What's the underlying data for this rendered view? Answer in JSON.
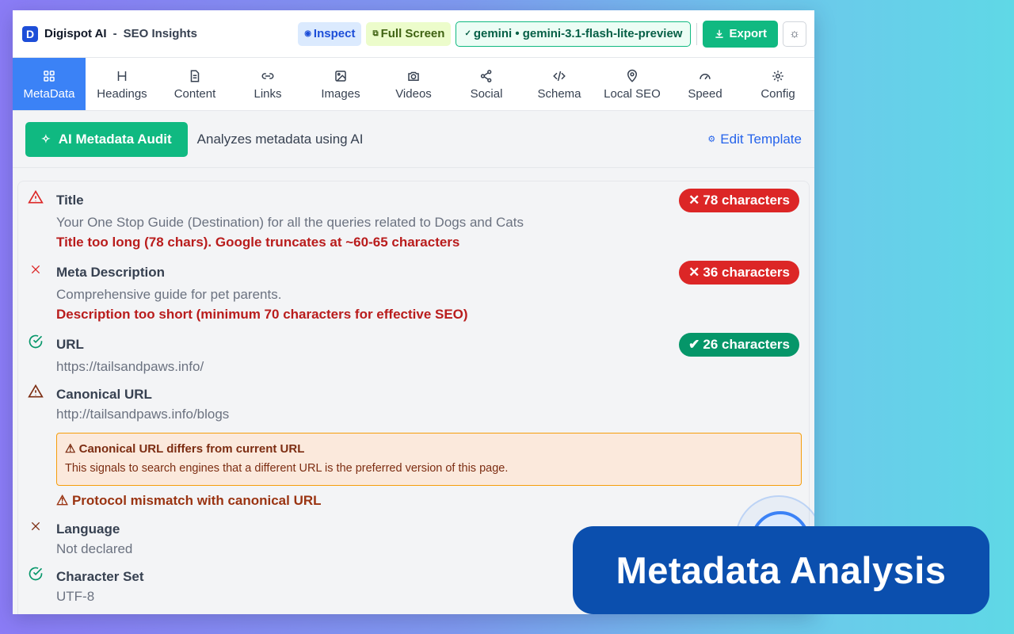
{
  "app": {
    "logo_letter": "D",
    "brand": "Digispot AI",
    "separator": "-",
    "subtitle": "SEO Insights"
  },
  "header": {
    "inspect_label": "Inspect",
    "fullscreen_label": "Full Screen",
    "model_label": "gemini • gemini-3.1-flash-lite-preview",
    "export_label": "Export",
    "theme_icon": "sun-icon"
  },
  "tabs": [
    {
      "label": "MetaData",
      "icon": "grid-icon",
      "active": true
    },
    {
      "label": "Headings",
      "icon": "heading-icon"
    },
    {
      "label": "Content",
      "icon": "document-icon"
    },
    {
      "label": "Links",
      "icon": "link-icon"
    },
    {
      "label": "Images",
      "icon": "image-icon"
    },
    {
      "label": "Videos",
      "icon": "camera-icon"
    },
    {
      "label": "Social",
      "icon": "share-icon"
    },
    {
      "label": "Schema",
      "icon": "code-icon"
    },
    {
      "label": "Local SEO",
      "icon": "map-pin-icon"
    },
    {
      "label": "Speed",
      "icon": "gauge-icon"
    },
    {
      "label": "Config",
      "icon": "gear-icon"
    }
  ],
  "audit": {
    "button_label": "AI Metadata Audit",
    "description": "Analyzes metadata using AI",
    "edit_template_label": "Edit Template"
  },
  "items": {
    "title": {
      "label": "Title",
      "value": "Your One Stop Guide (Destination) for all the queries related to Dogs and Cats",
      "error": "Title too long (78 chars). Google truncates at ~60-65 characters",
      "badge": "78 characters",
      "status": "warning"
    },
    "meta_description": {
      "label": "Meta Description",
      "value": "Comprehensive guide for pet parents.",
      "error": "Description too short (minimum 70 characters for effective SEO)",
      "badge": "36 characters",
      "status": "error"
    },
    "url": {
      "label": "URL",
      "value": "https://tailsandpaws.info/",
      "badge": "26 characters",
      "status": "ok"
    },
    "canonical": {
      "label": "Canonical URL",
      "value": "http://tailsandpaws.info/blogs",
      "warning_title": "Canonical URL differs from current URL",
      "warning_text": "This signals to search engines that a different URL is the preferred version of this page.",
      "protocol_warning": "Protocol mismatch with canonical URL",
      "status": "warning"
    },
    "language": {
      "label": "Language",
      "value": "Not declared",
      "status": "error"
    },
    "charset": {
      "label": "Character Set",
      "value": "UTF-8",
      "status": "ok"
    }
  },
  "overlay": {
    "text": "Metadata Analysis"
  },
  "colors": {
    "accent_green": "#10b981",
    "active_tab": "#3b82f6",
    "error_red": "#dc2626",
    "ok_green": "#059669",
    "overlay_blue": "#0b4fae"
  }
}
